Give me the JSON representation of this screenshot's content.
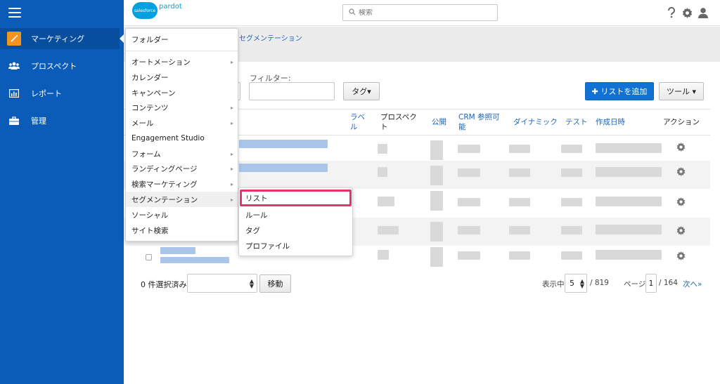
{
  "sidebar": {
    "items": [
      {
        "label": "マーケティング",
        "icon": "magic-wand-icon"
      },
      {
        "label": "プロスペクト",
        "icon": "people-icon"
      },
      {
        "label": "レポート",
        "icon": "report-chart-icon"
      },
      {
        "label": "管理",
        "icon": "briefcase-icon"
      }
    ]
  },
  "header": {
    "logo_cloud": "salesforce",
    "logo_product": "pardot",
    "search_placeholder": "検索"
  },
  "breadcrumb": {
    "current": "セグメンテーション"
  },
  "toolbar": {
    "filter_label": "フィルター:",
    "tag_button": "タグ▾",
    "add_list_button": "✚ リストを追加",
    "tools_button": "ツール ▾"
  },
  "table": {
    "columns": [
      "ラベル",
      "プロスペクト",
      "公開",
      "CRM 参照可能",
      "ダイナミック",
      "テスト",
      "作成日時",
      "アクション"
    ]
  },
  "marketing_menu": {
    "items": [
      {
        "label": "フォルダー",
        "submenu": false
      },
      {
        "label": "オートメーション",
        "submenu": true
      },
      {
        "label": "カレンダー",
        "submenu": false
      },
      {
        "label": "キャンペーン",
        "submenu": false
      },
      {
        "label": "コンテンツ",
        "submenu": true
      },
      {
        "label": "メール",
        "submenu": true
      },
      {
        "label": "Engagement Studio",
        "submenu": false
      },
      {
        "label": "フォーム",
        "submenu": true
      },
      {
        "label": "ランディングページ",
        "submenu": true
      },
      {
        "label": "検索マーケティング",
        "submenu": true
      },
      {
        "label": "セグメンテーション",
        "submenu": true
      },
      {
        "label": "ソーシャル",
        "submenu": false
      },
      {
        "label": "サイト検索",
        "submenu": false
      }
    ]
  },
  "segmentation_submenu": {
    "items": [
      "リスト",
      "ルール",
      "タグ",
      "プロファイル"
    ]
  },
  "footer": {
    "selected_label": "0 件選択済み:",
    "move_button": "移動",
    "per_page_label": "表示中",
    "per_page_value": "5",
    "total": "/ 819",
    "page_label": "ページ",
    "page_value": "1",
    "page_total": "/ 164",
    "next_link": "次へ»"
  },
  "colors": {
    "sidebar": "#0b5cb8",
    "accent": "#1172d4",
    "highlight_box": "#e8326a",
    "marketing_icon": "#f49420"
  }
}
